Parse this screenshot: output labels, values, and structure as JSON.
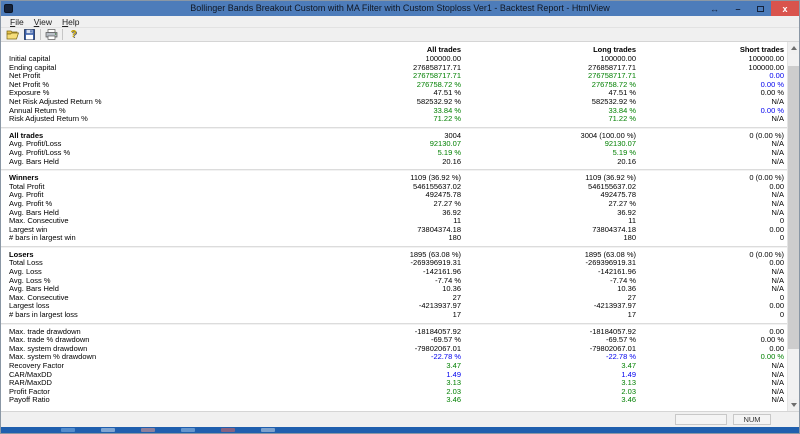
{
  "window": {
    "title": "Bollinger Bands Breakout Custom with MA Filter with Custom Stoploss Ver1 - Backtest Report - HtmlView",
    "controls": {
      "arrows": "↔",
      "minimize": "–",
      "close": "x"
    }
  },
  "menu": {
    "items": [
      "File",
      "View",
      "Help"
    ]
  },
  "toolbar": {
    "icons": [
      "open-icon",
      "save-icon",
      "print-icon",
      "help-icon"
    ]
  },
  "colors": {
    "black": "#000000",
    "green": "#008000",
    "blue": "#0000ee",
    "titlebar": "#4d7cba",
    "close_red": "#d9544d"
  },
  "report": {
    "columns": [
      "All trades",
      "Long trades",
      "Short trades"
    ],
    "sections": [
      {
        "title": null,
        "values": null,
        "rows": [
          {
            "label": "Initial capital",
            "v": [
              "100000.00",
              "100000.00",
              "100000.00"
            ],
            "c": [
              "k",
              "k",
              "k"
            ]
          },
          {
            "label": "Ending capital",
            "v": [
              "276858717.71",
              "276858717.71",
              "100000.00"
            ],
            "c": [
              "k",
              "k",
              "k"
            ]
          },
          {
            "label": "Net Profit",
            "v": [
              "276758717.71",
              "276758717.71",
              "0.00"
            ],
            "c": [
              "g",
              "g",
              "b"
            ]
          },
          {
            "label": "Net Profit %",
            "v": [
              "276758.72 %",
              "276758.72 %",
              "0.00 %"
            ],
            "c": [
              "g",
              "g",
              "b"
            ]
          },
          {
            "label": "Exposure %",
            "v": [
              "47.51 %",
              "47.51 %",
              "0.00 %"
            ],
            "c": [
              "k",
              "k",
              "k"
            ]
          },
          {
            "label": "Net Risk Adjusted Return %",
            "v": [
              "582532.92 %",
              "582532.92 %",
              "N/A"
            ],
            "c": [
              "k",
              "k",
              "k"
            ]
          },
          {
            "label": "Annual Return %",
            "v": [
              "33.84 %",
              "33.84 %",
              "0.00 %"
            ],
            "c": [
              "g",
              "g",
              "b"
            ]
          },
          {
            "label": "Risk Adjusted Return %",
            "v": [
              "71.22 %",
              "71.22 %",
              "N/A"
            ],
            "c": [
              "g",
              "g",
              "k"
            ]
          }
        ]
      },
      {
        "title": "All trades",
        "values": [
          "3004",
          "3004 (100.00 %)",
          "0 (0.00 %)"
        ],
        "value_colors": [
          "k",
          "k",
          "k"
        ],
        "rows": [
          {
            "label": "Avg. Profit/Loss",
            "v": [
              "92130.07",
              "92130.07",
              "N/A"
            ],
            "c": [
              "g",
              "g",
              "k"
            ]
          },
          {
            "label": "Avg. Profit/Loss %",
            "v": [
              "5.19 %",
              "5.19 %",
              "N/A"
            ],
            "c": [
              "g",
              "g",
              "k"
            ]
          },
          {
            "label": "Avg. Bars Held",
            "v": [
              "20.16",
              "20.16",
              "N/A"
            ],
            "c": [
              "k",
              "k",
              "k"
            ]
          }
        ]
      },
      {
        "title": "Winners",
        "values": [
          "1109 (36.92 %)",
          "1109 (36.92 %)",
          "0 (0.00 %)"
        ],
        "value_colors": [
          "k",
          "k",
          "k"
        ],
        "rows": [
          {
            "label": "Total Profit",
            "v": [
              "546155637.02",
              "546155637.02",
              "0.00"
            ],
            "c": [
              "k",
              "k",
              "k"
            ]
          },
          {
            "label": "Avg. Profit",
            "v": [
              "492475.78",
              "492475.78",
              "N/A"
            ],
            "c": [
              "k",
              "k",
              "k"
            ]
          },
          {
            "label": "Avg. Profit %",
            "v": [
              "27.27 %",
              "27.27 %",
              "N/A"
            ],
            "c": [
              "k",
              "k",
              "k"
            ]
          },
          {
            "label": "Avg. Bars Held",
            "v": [
              "36.92",
              "36.92",
              "N/A"
            ],
            "c": [
              "k",
              "k",
              "k"
            ]
          },
          {
            "label": "Max. Consecutive",
            "v": [
              "11",
              "11",
              "0"
            ],
            "c": [
              "k",
              "k",
              "k"
            ]
          },
          {
            "label": "Largest win",
            "v": [
              "73804374.18",
              "73804374.18",
              "0.00"
            ],
            "c": [
              "k",
              "k",
              "k"
            ]
          },
          {
            "label": "# bars in largest win",
            "v": [
              "180",
              "180",
              "0"
            ],
            "c": [
              "k",
              "k",
              "k"
            ]
          }
        ]
      },
      {
        "title": "Losers",
        "values": [
          "1895 (63.08 %)",
          "1895 (63.08 %)",
          "0 (0.00 %)"
        ],
        "value_colors": [
          "k",
          "k",
          "k"
        ],
        "rows": [
          {
            "label": "Total Loss",
            "v": [
              "-269396919.31",
              "-269396919.31",
              "0.00"
            ],
            "c": [
              "k",
              "k",
              "k"
            ]
          },
          {
            "label": "Avg. Loss",
            "v": [
              "-142161.96",
              "-142161.96",
              "N/A"
            ],
            "c": [
              "k",
              "k",
              "k"
            ]
          },
          {
            "label": "Avg. Loss %",
            "v": [
              "-7.74 %",
              "-7.74 %",
              "N/A"
            ],
            "c": [
              "k",
              "k",
              "k"
            ]
          },
          {
            "label": "Avg. Bars Held",
            "v": [
              "10.36",
              "10.36",
              "N/A"
            ],
            "c": [
              "k",
              "k",
              "k"
            ]
          },
          {
            "label": "Max. Consecutive",
            "v": [
              "27",
              "27",
              "0"
            ],
            "c": [
              "k",
              "k",
              "k"
            ]
          },
          {
            "label": "Largest loss",
            "v": [
              "-4213937.97",
              "-4213937.97",
              "0.00"
            ],
            "c": [
              "k",
              "k",
              "k"
            ]
          },
          {
            "label": "# bars in largest loss",
            "v": [
              "17",
              "17",
              "0"
            ],
            "c": [
              "k",
              "k",
              "k"
            ]
          }
        ]
      },
      {
        "title": null,
        "values": null,
        "rows": [
          {
            "label": "Max. trade drawdown",
            "v": [
              "-18184057.92",
              "-18184057.92",
              "0.00"
            ],
            "c": [
              "k",
              "k",
              "k"
            ]
          },
          {
            "label": "Max. trade % drawdown",
            "v": [
              "-69.57 %",
              "-69.57 %",
              "0.00 %"
            ],
            "c": [
              "k",
              "k",
              "k"
            ]
          },
          {
            "label": "Max. system drawdown",
            "v": [
              "-79802067.01",
              "-79802067.01",
              "0.00"
            ],
            "c": [
              "k",
              "k",
              "k"
            ]
          },
          {
            "label": "Max. system % drawdown",
            "v": [
              "-22.78 %",
              "-22.78 %",
              "0.00 %"
            ],
            "c": [
              "b",
              "b",
              "g"
            ]
          },
          {
            "label": "Recovery Factor",
            "v": [
              "3.47",
              "3.47",
              "N/A"
            ],
            "c": [
              "g",
              "g",
              "k"
            ]
          },
          {
            "label": "CAR/MaxDD",
            "v": [
              "1.49",
              "1.49",
              "N/A"
            ],
            "c": [
              "b",
              "b",
              "k"
            ]
          },
          {
            "label": "RAR/MaxDD",
            "v": [
              "3.13",
              "3.13",
              "N/A"
            ],
            "c": [
              "g",
              "g",
              "k"
            ]
          },
          {
            "label": "Profit Factor",
            "v": [
              "2.03",
              "2.03",
              "N/A"
            ],
            "c": [
              "g",
              "g",
              "k"
            ]
          },
          {
            "label": "Payoff Ratio",
            "v": [
              "3.46",
              "3.46",
              "N/A"
            ],
            "c": [
              "g",
              "g",
              "k"
            ]
          }
        ]
      }
    ]
  },
  "statusbar": {
    "num_indicator": "NUM"
  }
}
